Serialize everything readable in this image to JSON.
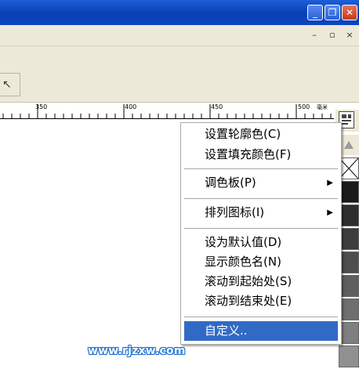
{
  "window": {
    "minimize_label": "_",
    "restore_label": "❐",
    "close_label": "✕"
  },
  "mdi": {
    "minimize_label": "–",
    "restore_label": "▫",
    "close_label": "×"
  },
  "ruler": {
    "labels": [
      "350",
      "400",
      "450",
      "500"
    ],
    "unit": "毫米"
  },
  "palette": {
    "swatch_colors": [
      "#ffffff",
      "#1a1a1a",
      "#2d2d2d",
      "#3c3c3c",
      "#4d4d4d",
      "#5e5e5e",
      "#6e6e6e",
      "#7f7f7f",
      "#909090"
    ]
  },
  "context_menu": {
    "items": [
      {
        "label": "设置轮廓色(C)"
      },
      {
        "label": "设置填充颜色(F)"
      },
      {
        "label": "调色板(P)",
        "submenu": true
      },
      {
        "label": "排列图标(I)",
        "submenu": true
      },
      {
        "label": "设为默认值(D)"
      },
      {
        "label": "显示颜色名(N)"
      },
      {
        "label": "滚动到起始处(S)"
      },
      {
        "label": "滚动到结束处(E)"
      },
      {
        "label": "自定义..",
        "selected": true
      }
    ],
    "submenu_arrow": "▶"
  },
  "watermark": "www.rjzxw.com"
}
